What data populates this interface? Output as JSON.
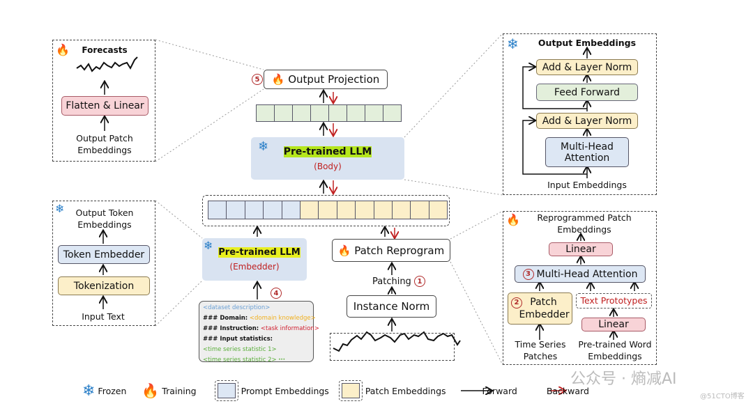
{
  "forecast_panel": {
    "title": "Forecasts",
    "layer": "Flatten & Linear",
    "input": "Output Patch Embeddings",
    "icon": "fire-icon"
  },
  "output_projection": {
    "step": "5",
    "label": "Output Projection",
    "icon": "fire-icon"
  },
  "llm_body": {
    "title": "Pre-trained LLM",
    "subtitle": "(Body)",
    "icon": "snowflake-icon"
  },
  "transformer_panel": {
    "title": "Output Embeddings",
    "add_norm_top": "Add & Layer Norm",
    "feed_forward": "Feed Forward",
    "add_norm_bottom": "Add & Layer Norm",
    "attention": "Multi-Head Attention",
    "input": "Input Embeddings",
    "icon": "snowflake-icon"
  },
  "token_panel": {
    "title": "Output Token Embeddings",
    "embedder": "Token Embedder",
    "tokenization": "Tokenization",
    "input": "Input Text",
    "icon": "snowflake-icon"
  },
  "llm_embedder": {
    "title": "Pre-trained LLM",
    "subtitle": "(Embedder)",
    "step": "4",
    "icon": "snowflake-icon"
  },
  "prompt": {
    "line1": "<dataset description>",
    "domain_key": "### Domain:",
    "domain_val": "<domain knowledge>",
    "instr_key": "### Instruction:",
    "instr_val": "<task information>",
    "stats_key": "### Input statistics:",
    "stat1": "<time series statistic 1>",
    "stat2": "<time series statistic 2>",
    "ellipsis": "···"
  },
  "patch_reprogram": {
    "label": "Patch Reprogram",
    "icon": "fire-icon"
  },
  "patching": {
    "label": "Patching",
    "step": "1"
  },
  "instance_norm": {
    "label": "Instance Norm"
  },
  "reprogram_panel": {
    "title": "Reprogrammed Patch Embeddings",
    "linear_top": "Linear",
    "attention_step": "3",
    "attention": "Multi-Head Attention",
    "embedder_step": "2",
    "embedder": "Patch Embedder",
    "prototypes": "Text Prototypes",
    "linear_bottom": "Linear",
    "input_left": "Time Series Patches",
    "input_right": "Pre-trained Word Embeddings",
    "icon": "fire-icon"
  },
  "legend": {
    "frozen": "Frozen",
    "training": "Training",
    "prompt_emb": "Prompt Embeddings",
    "patch_emb": "Patch Embeddings",
    "forward": "Forward",
    "backward": "Backward"
  },
  "watermark": {
    "main": "公众号 · 熵减AI",
    "sub": "@51CTO博客"
  },
  "colors": {
    "prompt": "#dde7f4",
    "patch": "#fcefc9",
    "output": "#e3efdb",
    "linear": "#f8d3d7",
    "backward": "#c02020",
    "highlight": "#b5e61d"
  }
}
